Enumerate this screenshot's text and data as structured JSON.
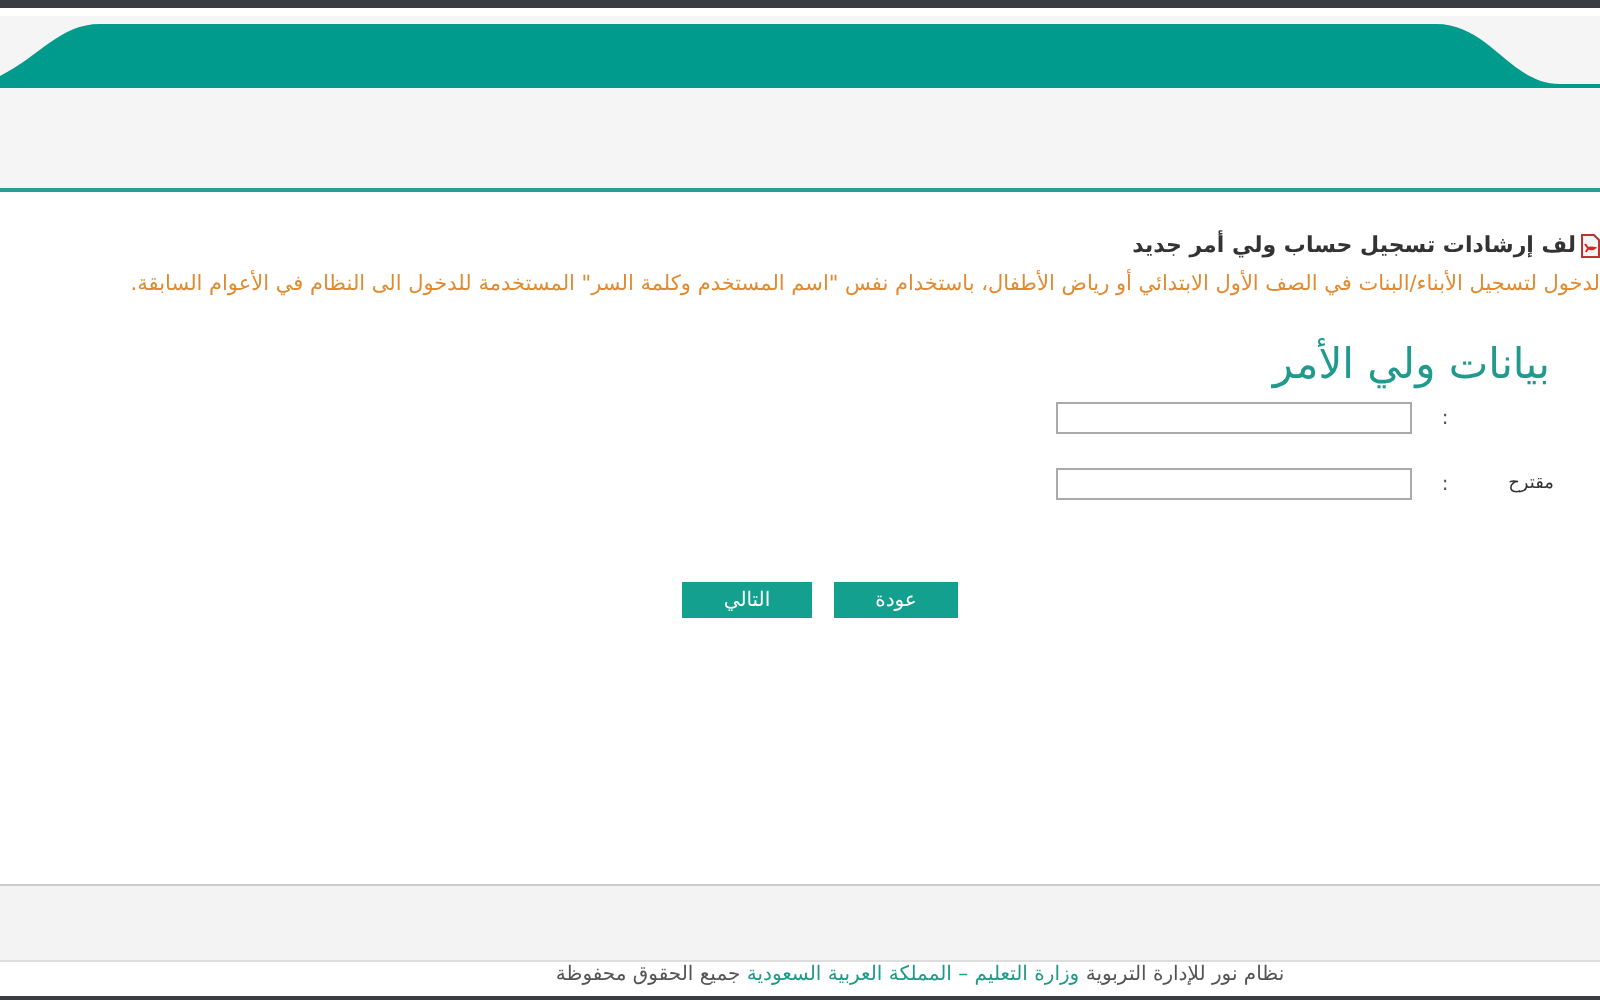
{
  "guide_link": {
    "text": "لف إرشادات تسجيل حساب ولي أمر جديد"
  },
  "notice": "لدخول لتسجيل الأبناء/البنات في الصف الأول الابتدائي أو رياض الأطفال، باستخدام نفس \"اسم المستخدم وكلمة السر\" المستخدمة للدخول الى النظام في الأعوام السابقة.",
  "section_title": "بيانات ولي الأمر",
  "fields": [
    {
      "separator": ":"
    },
    {
      "label": "مقترح",
      "separator": ":"
    }
  ],
  "buttons": [
    {
      "label": "عودة"
    },
    {
      "label": "التالي"
    }
  ],
  "footer": [
    {
      "text": "نظام نور للإدارة التربوية",
      "link": false
    },
    {
      "text": "وزارة التعليم – المملكة العربية السعودية",
      "link": true
    },
    {
      "text": "جميع الحقوق محفوظة",
      "link": false
    }
  ]
}
